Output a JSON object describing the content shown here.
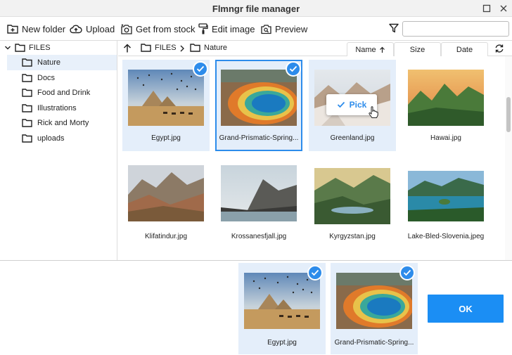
{
  "window": {
    "title": "Flmngr file manager"
  },
  "toolbar": {
    "new_folder": "New folder",
    "upload": "Upload",
    "get_from_stock": "Get from stock",
    "edit_image": "Edit image",
    "preview": "Preview",
    "search_value": ""
  },
  "tree": {
    "root": "FILES",
    "items": [
      "Nature",
      "Docs",
      "Food and Drink",
      "Illustrations",
      "Rick and Morty",
      "uploads"
    ]
  },
  "breadcrumb": {
    "root": "FILES",
    "current": "Nature"
  },
  "sort": {
    "name": "Name",
    "size": "Size",
    "date": "Date"
  },
  "files": [
    {
      "name": "Egypt.jpg"
    },
    {
      "name": "Grand-Prismatic-Spring..."
    },
    {
      "name": "Greenland.jpg"
    },
    {
      "name": "Hawai.jpg"
    },
    {
      "name": "Klifatindur.jpg"
    },
    {
      "name": "Krossanesfjall.jpg"
    },
    {
      "name": "Kyrgyzstan.jpg"
    },
    {
      "name": "Lake-Bled-Slovenia.jpeg"
    }
  ],
  "pick_label": "Pick",
  "selected": [
    {
      "name": "Egypt.jpg"
    },
    {
      "name": "Grand-Prismatic-Spring..."
    }
  ],
  "ok_label": "OK",
  "colors": {
    "accent": "#2d8ceb",
    "ok_button": "#1b8ef4",
    "selection_bg": "#e4eefa"
  }
}
